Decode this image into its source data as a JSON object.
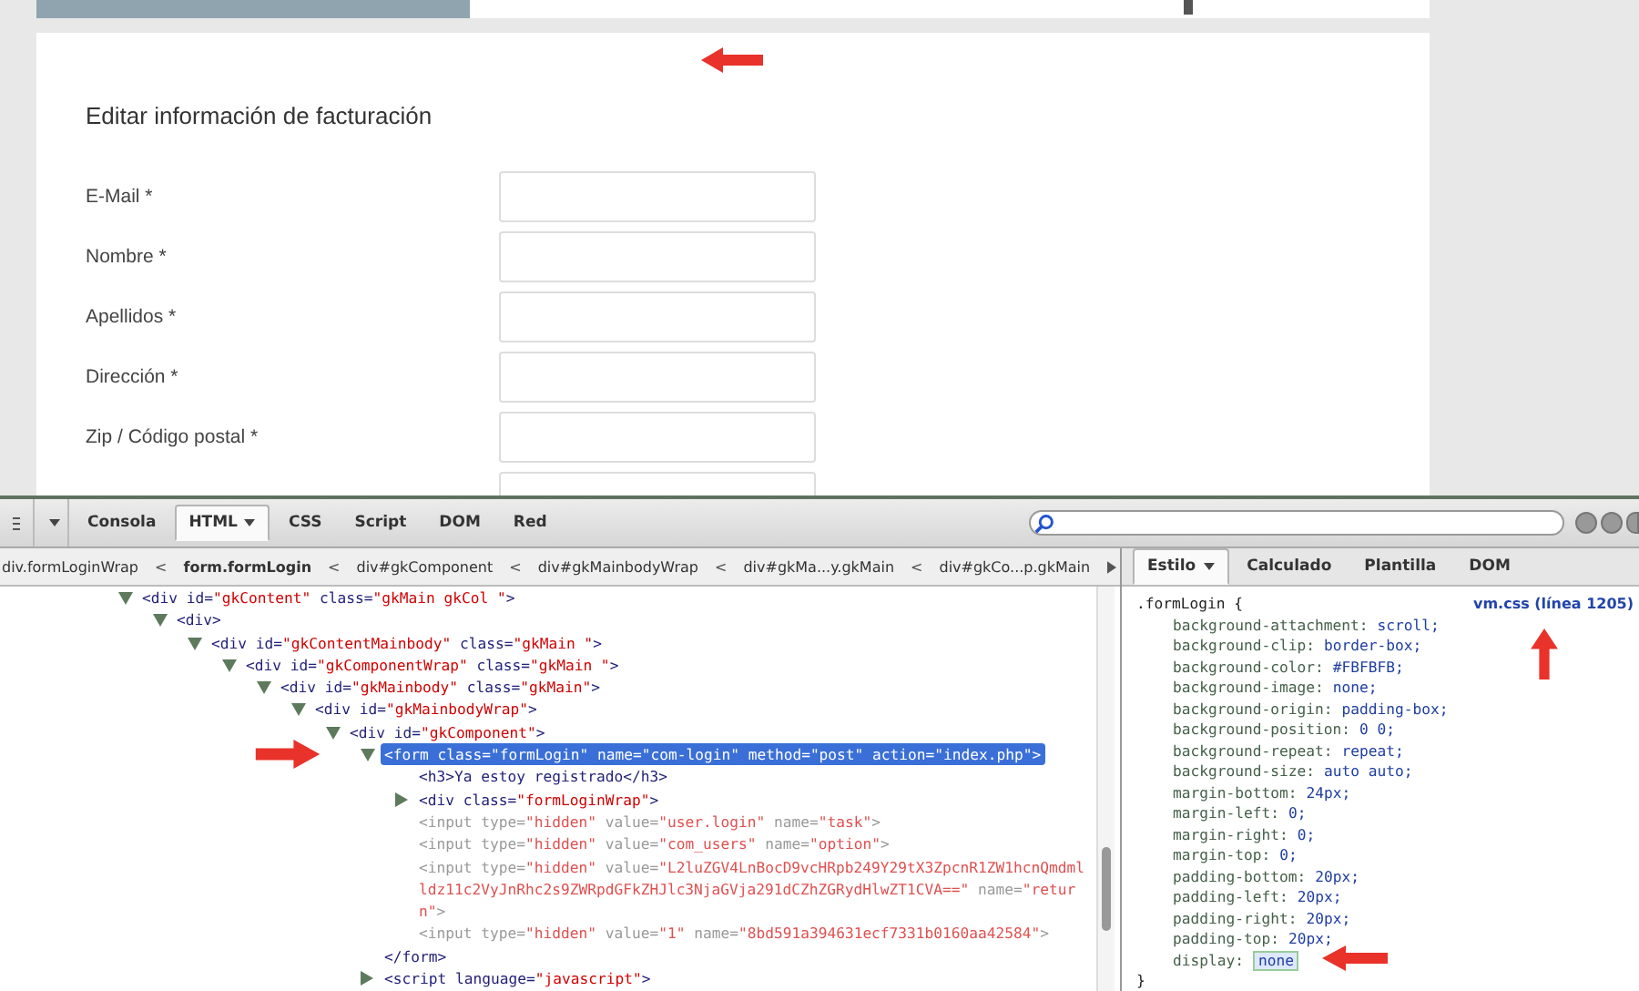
{
  "site": {
    "form_title": "Editar información de facturación",
    "fields": [
      {
        "label": "E-Mail *"
      },
      {
        "label": "Nombre *"
      },
      {
        "label": "Apellidos *"
      },
      {
        "label": "Dirección *"
      },
      {
        "label": "Zip / Código postal *"
      }
    ]
  },
  "devtools": {
    "tabs": [
      {
        "label": "Consola",
        "selected": false,
        "menu": false
      },
      {
        "label": "HTML",
        "selected": true,
        "menu": true
      },
      {
        "label": "CSS",
        "selected": false,
        "menu": false
      },
      {
        "label": "Script",
        "selected": false,
        "menu": false
      },
      {
        "label": "DOM",
        "selected": false,
        "menu": false
      },
      {
        "label": "Red",
        "selected": false,
        "menu": false
      }
    ],
    "breadcrumb": [
      {
        "label": "div.formLoginWrap",
        "selected": false
      },
      {
        "label": "form.formLogin",
        "selected": true
      },
      {
        "label": "div#gkComponent",
        "selected": false
      },
      {
        "label": "div#gkMainbodyWrap",
        "selected": false
      },
      {
        "label": "div#gkMa...y.gkMain",
        "selected": false
      },
      {
        "label": "div#gkCo...p.gkMain",
        "selected": false
      }
    ],
    "breadcrumb_separator": "<",
    "tree": [
      {
        "text": "<div id=\"gkContent\" class=\"gkMain gkCol \">",
        "expanded": true,
        "selected": false,
        "dimmed": false,
        "children": [
          {
            "text": "<div>",
            "expanded": true,
            "selected": false,
            "dimmed": false,
            "children": [
              {
                "text": "<div id=\"gkContentMainbody\" class=\"gkMain \">",
                "expanded": true,
                "selected": false,
                "dimmed": false,
                "children": [
                  {
                    "text": "<div id=\"gkComponentWrap\" class=\"gkMain \">",
                    "expanded": true,
                    "selected": false,
                    "dimmed": false,
                    "children": [
                      {
                        "text": "<div id=\"gkMainbody\" class=\"gkMain\">",
                        "expanded": true,
                        "selected": false,
                        "dimmed": false,
                        "children": [
                          {
                            "text": "<div id=\"gkMainbodyWrap\">",
                            "expanded": true,
                            "selected": false,
                            "dimmed": false,
                            "children": [
                              {
                                "text": "<div id=\"gkComponent\">",
                                "expanded": true,
                                "selected": false,
                                "dimmed": false,
                                "children": [
                                  {
                                    "text": "<form class=\"formLogin\" name=\"com-login\" method=\"post\" action=\"index.php\">",
                                    "expanded": true,
                                    "selected": true,
                                    "dimmed": false,
                                    "close": "</form>",
                                    "children": [
                                      {
                                        "text": "<h3>Ya estoy registrado</h3>",
                                        "selected": false,
                                        "dimmed": false
                                      },
                                      {
                                        "text": "<div class=\"formLoginWrap\">",
                                        "expanded": false,
                                        "selected": false,
                                        "dimmed": false
                                      },
                                      {
                                        "text": "<input type=\"hidden\" value=\"user.login\" name=\"task\">",
                                        "selected": false,
                                        "dimmed": true
                                      },
                                      {
                                        "text": "<input type=\"hidden\" value=\"com_users\" name=\"option\">",
                                        "selected": false,
                                        "dimmed": true
                                      },
                                      {
                                        "text": "<input type=\"hidden\" value=\"L2luZGV4LnBocD9vcHRpb249Y29tX3ZpcnR1ZW1hcnQmdmlldz11c2VyJnRhc2s9ZWRpdGFkZHJlc3NjaGVja291dCZhZGRydHlwZT1CVA==\" name=\"return\">",
                                        "selected": false,
                                        "dimmed": true
                                      },
                                      {
                                        "text": "<input type=\"hidden\" value=\"1\" name=\"8bd591a394631ecf7331b0160aa42584\">",
                                        "selected": false,
                                        "dimmed": true
                                      }
                                    ]
                                  },
                                  {
                                    "text": "<script language=\"javascript\">",
                                    "expanded": false,
                                    "selected": false,
                                    "dimmed": false
                                  }
                                ]
                              }
                            ]
                          }
                        ]
                      }
                    ]
                  }
                ]
              }
            ]
          }
        ]
      }
    ],
    "side_tabs": [
      {
        "label": "Estilo",
        "selected": true,
        "menu": true
      },
      {
        "label": "Calculado",
        "selected": false,
        "menu": false
      },
      {
        "label": "Plantilla",
        "selected": false,
        "menu": false
      },
      {
        "label": "DOM",
        "selected": false,
        "menu": false
      }
    ],
    "rule": {
      "selector": ".formLogin {",
      "source": "vm.css (línea 1205)",
      "close": "}",
      "properties": [
        {
          "name": "background-attachment:",
          "value": "scroll;",
          "editing": false
        },
        {
          "name": "background-clip:",
          "value": "border-box;",
          "editing": false
        },
        {
          "name": "background-color:",
          "value": "#FBFBFB;",
          "editing": false
        },
        {
          "name": "background-image:",
          "value": "none;",
          "editing": false
        },
        {
          "name": "background-origin:",
          "value": "padding-box;",
          "editing": false
        },
        {
          "name": "background-position:",
          "value": "0 0;",
          "editing": false
        },
        {
          "name": "background-repeat:",
          "value": "repeat;",
          "editing": false
        },
        {
          "name": "background-size:",
          "value": "auto auto;",
          "editing": false
        },
        {
          "name": "margin-bottom:",
          "value": "24px;",
          "editing": false
        },
        {
          "name": "margin-left:",
          "value": "0;",
          "editing": false
        },
        {
          "name": "margin-right:",
          "value": "0;",
          "editing": false
        },
        {
          "name": "margin-top:",
          "value": "0;",
          "editing": false
        },
        {
          "name": "padding-bottom:",
          "value": "20px;",
          "editing": false
        },
        {
          "name": "padding-left:",
          "value": "20px;",
          "editing": false
        },
        {
          "name": "padding-right:",
          "value": "20px;",
          "editing": false
        },
        {
          "name": "padding-top:",
          "value": "20px;",
          "editing": false
        },
        {
          "name": "display:",
          "value": "none",
          "editing": true
        }
      ]
    }
  }
}
